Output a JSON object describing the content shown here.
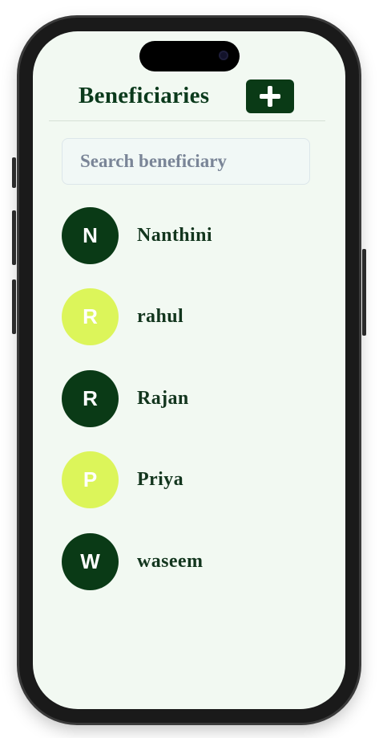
{
  "header": {
    "title": "Beneficiaries",
    "add_button_icon": "plus-icon"
  },
  "search": {
    "placeholder": "Search beneficiary",
    "value": ""
  },
  "colors": {
    "dark_green": "#0a3a16",
    "lime": "#dcf55a",
    "screen_bg": "#f2f9f2"
  },
  "beneficiaries": [
    {
      "initial": "N",
      "name": "Nanthini",
      "avatar_color": "#0a3a16"
    },
    {
      "initial": "R",
      "name": "rahul",
      "avatar_color": "#dcf55a"
    },
    {
      "initial": "R",
      "name": "Rajan",
      "avatar_color": "#0a3a16"
    },
    {
      "initial": "P",
      "name": "Priya",
      "avatar_color": "#dcf55a"
    },
    {
      "initial": "W",
      "name": "waseem",
      "avatar_color": "#0a3a16"
    }
  ]
}
